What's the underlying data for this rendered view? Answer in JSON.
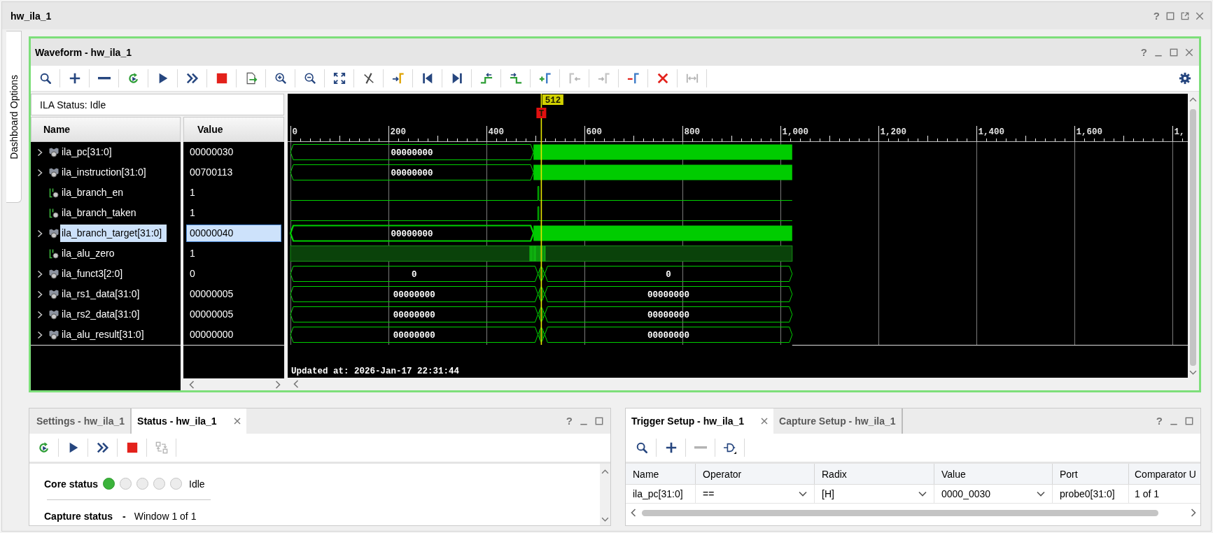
{
  "window": {
    "title": "hw_ila_1",
    "help": "?"
  },
  "side_tab": {
    "label": "Dashboard Options"
  },
  "waveform": {
    "title": "Waveform - hw_ila_1",
    "help": "?",
    "toolbar": [
      {
        "kind": "search",
        "disabled": false
      },
      {
        "kind": "add",
        "disabled": false
      },
      {
        "kind": "remove",
        "disabled": false
      },
      {
        "kind": "rerun",
        "disabled": false
      },
      {
        "kind": "run",
        "disabled": false
      },
      {
        "kind": "run_fast",
        "disabled": false
      },
      {
        "kind": "stop",
        "disabled": false
      },
      {
        "kind": "export",
        "disabled": false
      },
      {
        "kind": "zoom_in",
        "disabled": false
      },
      {
        "kind": "zoom_out",
        "disabled": false
      },
      {
        "kind": "zoom_fit",
        "disabled": false
      },
      {
        "kind": "cursor_off",
        "disabled": false
      },
      {
        "kind": "goto_cursor",
        "disabled": false
      },
      {
        "kind": "first",
        "disabled": false
      },
      {
        "kind": "last",
        "disabled": false
      },
      {
        "kind": "prev_edge",
        "disabled": false
      },
      {
        "kind": "next_edge",
        "disabled": false
      },
      {
        "kind": "add_marker",
        "disabled": false
      },
      {
        "kind": "prev_marker",
        "disabled": true
      },
      {
        "kind": "next_marker",
        "disabled": true
      },
      {
        "kind": "delete_marker",
        "disabled": false
      },
      {
        "kind": "delete_all",
        "disabled": false
      },
      {
        "kind": "measure",
        "disabled": true
      }
    ],
    "status": "ILA Status: Idle",
    "columns": [
      "Name",
      "Value"
    ],
    "signals": [
      {
        "name": "ila_pc[31:0]",
        "value": "00000030",
        "kind": "bus",
        "selected": false,
        "trace": {
          "kind": "busy",
          "labels": [
            "00000000"
          ]
        }
      },
      {
        "name": "ila_instruction[31:0]",
        "value": "00700113",
        "kind": "bus",
        "selected": false,
        "trace": {
          "kind": "busy",
          "labels": [
            "00000000"
          ]
        }
      },
      {
        "name": "ila_branch_en",
        "value": "1",
        "kind": "bit",
        "selected": false,
        "trace": {
          "kind": "low"
        }
      },
      {
        "name": "ila_branch_taken",
        "value": "1",
        "kind": "bit",
        "selected": false,
        "trace": {
          "kind": "low"
        }
      },
      {
        "name": "ila_branch_target[31:0]",
        "value": "00000040",
        "kind": "bus",
        "selected": true,
        "trace": {
          "kind": "busy",
          "labels": [
            "00000000"
          ]
        }
      },
      {
        "name": "ila_alu_zero",
        "value": "1",
        "kind": "bit",
        "selected": false,
        "trace": {
          "kind": "toggle"
        }
      },
      {
        "name": "ila_funct3[2:0]",
        "value": "0",
        "kind": "bus",
        "selected": false,
        "trace": {
          "kind": "split",
          "labels": [
            "0",
            "0"
          ]
        }
      },
      {
        "name": "ila_rs1_data[31:0]",
        "value": "00000005",
        "kind": "bus",
        "selected": false,
        "trace": {
          "kind": "split",
          "labels": [
            "00000000",
            "00000000"
          ]
        }
      },
      {
        "name": "ila_rs2_data[31:0]",
        "value": "00000005",
        "kind": "bus",
        "selected": false,
        "trace": {
          "kind": "split",
          "labels": [
            "00000000",
            "00000000"
          ]
        }
      },
      {
        "name": "ila_alu_result[31:0]",
        "value": "00000000",
        "kind": "bus",
        "selected": false,
        "trace": {
          "kind": "split",
          "labels": [
            "00000000",
            "00000000"
          ]
        }
      }
    ],
    "ruler": [
      "0",
      "200",
      "400",
      "600",
      "800",
      "1,000",
      "1,200",
      "1,400",
      "1,600",
      "1,"
    ],
    "cursor": "512",
    "trigger_mark": "T",
    "updated": "Updated at: 2026-Jan-17 22:31:44"
  },
  "status_panel": {
    "help": "?",
    "tabs": [
      {
        "label": "Settings - hw_ila_1",
        "selected": false
      },
      {
        "label": "Status - hw_ila_1",
        "selected": true
      }
    ],
    "toolbar": [
      {
        "kind": "rerun",
        "disabled": false
      },
      {
        "kind": "run",
        "disabled": false
      },
      {
        "kind": "run_fast",
        "disabled": false
      },
      {
        "kind": "stop",
        "disabled": false
      },
      {
        "kind": "swap",
        "disabled": true
      }
    ],
    "core_status": {
      "label": "Core status",
      "lights": [
        {
          "on": true
        },
        {
          "on": false
        },
        {
          "on": false
        },
        {
          "on": false
        },
        {
          "on": false
        }
      ],
      "state": "Idle"
    },
    "capture_status": {
      "label": "Capture status",
      "separator": "-",
      "value": "Window 1 of 1"
    }
  },
  "trigger_panel": {
    "help": "?",
    "tabs": [
      {
        "label": "Trigger Setup - hw_ila_1",
        "selected": true
      },
      {
        "label": "Capture Setup - hw_ila_1",
        "selected": false
      }
    ],
    "toolbar": [
      {
        "kind": "search",
        "disabled": false
      },
      {
        "kind": "add",
        "disabled": false
      },
      {
        "kind": "remove",
        "disabled": true
      },
      {
        "kind": "gate",
        "disabled": false
      }
    ],
    "table": {
      "columns": [
        "Name",
        "Operator",
        "Radix",
        "Value",
        "Port",
        "Comparator U"
      ],
      "rows": [
        {
          "name": "ila_pc[31:0]",
          "operator": "==",
          "radix": "[H]",
          "value": "0000_0030",
          "port": "probe0[31:0]",
          "comparator": "1 of 1"
        }
      ]
    }
  }
}
